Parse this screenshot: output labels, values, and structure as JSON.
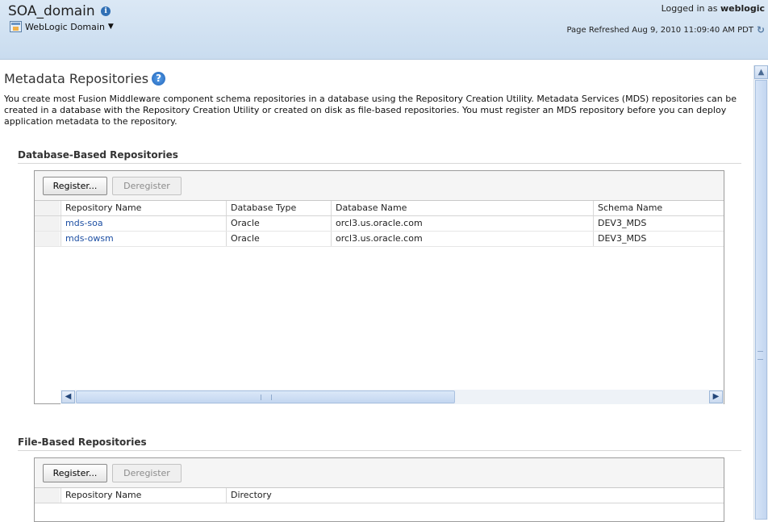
{
  "header": {
    "domain_title": "SOA_domain",
    "domain_menu_label": "WebLogic Domain",
    "logged_in_prefix": "Logged in as",
    "logged_in_user": "weblogic",
    "page_refreshed": "Page Refreshed Aug 9, 2010 11:09:40 AM PDT"
  },
  "page": {
    "title": "Metadata Repositories",
    "intro": "You create most Fusion Middleware component schema repositories in a database using the Repository Creation Utility. Metadata Services (MDS) repositories can be created in a database with the Repository Creation Utility or created on disk as file-based repositories. You must register an MDS repository before you can deploy application metadata to the repository."
  },
  "database_section": {
    "title": "Database-Based Repositories",
    "register_label": "Register...",
    "deregister_label": "Deregister",
    "columns": [
      "Repository Name",
      "Database Type",
      "Database Name",
      "Schema Name"
    ],
    "rows": [
      {
        "name": "mds-soa",
        "type": "Oracle",
        "db_name": "orcl3.us.oracle.com",
        "schema": "DEV3_MDS"
      },
      {
        "name": "mds-owsm",
        "type": "Oracle",
        "db_name": "orcl3.us.oracle.com",
        "schema": "DEV3_MDS"
      }
    ]
  },
  "file_section": {
    "title": "File-Based Repositories",
    "register_label": "Register...",
    "deregister_label": "Deregister",
    "columns": [
      "Repository Name",
      "Directory"
    ]
  },
  "icons": {
    "info": "info-icon",
    "help": "help-icon",
    "refresh": "refresh-icon",
    "domain": "weblogic-domain-icon"
  },
  "colors": {
    "header_bg": "#d3e3f3",
    "link": "#1d4fa3",
    "help_icon": "#2f74c7"
  }
}
